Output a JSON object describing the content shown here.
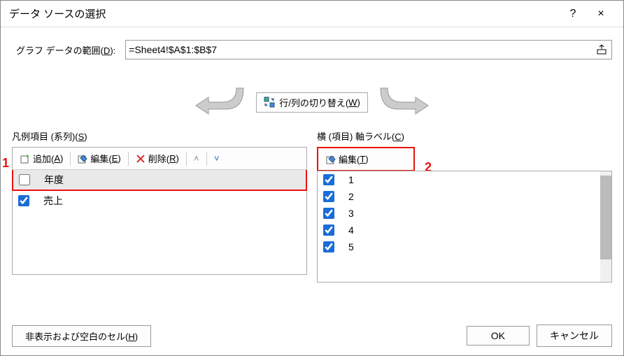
{
  "title": "データ ソースの選択",
  "help_icon": "?",
  "close_icon": "×",
  "range": {
    "label_pre": "グラフ データの範囲(",
    "label_key": "D",
    "label_post": "):",
    "value": "=Sheet4!$A$1:$B$7"
  },
  "swap": {
    "label_pre": "行/列の切り替え(",
    "label_key": "W",
    "label_post": ")"
  },
  "series": {
    "header_pre": "凡例項目 (系列)(",
    "header_key": "S",
    "header_post": ")",
    "add_pre": "追加(",
    "add_key": "A",
    "add_post": ")",
    "edit_pre": "編集(",
    "edit_key": "E",
    "edit_post": ")",
    "remove_pre": "削除(",
    "remove_key": "R",
    "remove_post": ")",
    "up": "˄",
    "down": "˅",
    "items": [
      {
        "label": "年度",
        "checked": false,
        "selected": true
      },
      {
        "label": "売上",
        "checked": true,
        "selected": false
      }
    ]
  },
  "axis": {
    "header_pre": "横 (項目) 軸ラベル(",
    "header_key": "C",
    "header_post": ")",
    "edit_pre": "編集(",
    "edit_key": "T",
    "edit_post": ")",
    "items": [
      {
        "label": "1",
        "checked": true
      },
      {
        "label": "2",
        "checked": true
      },
      {
        "label": "3",
        "checked": true
      },
      {
        "label": "4",
        "checked": true
      },
      {
        "label": "5",
        "checked": true
      }
    ]
  },
  "footer": {
    "hidden_pre": "非表示および空白のセル(",
    "hidden_key": "H",
    "hidden_post": ")",
    "ok": "OK",
    "cancel": "キャンセル"
  },
  "annotations": {
    "one": "1",
    "two": "2"
  }
}
